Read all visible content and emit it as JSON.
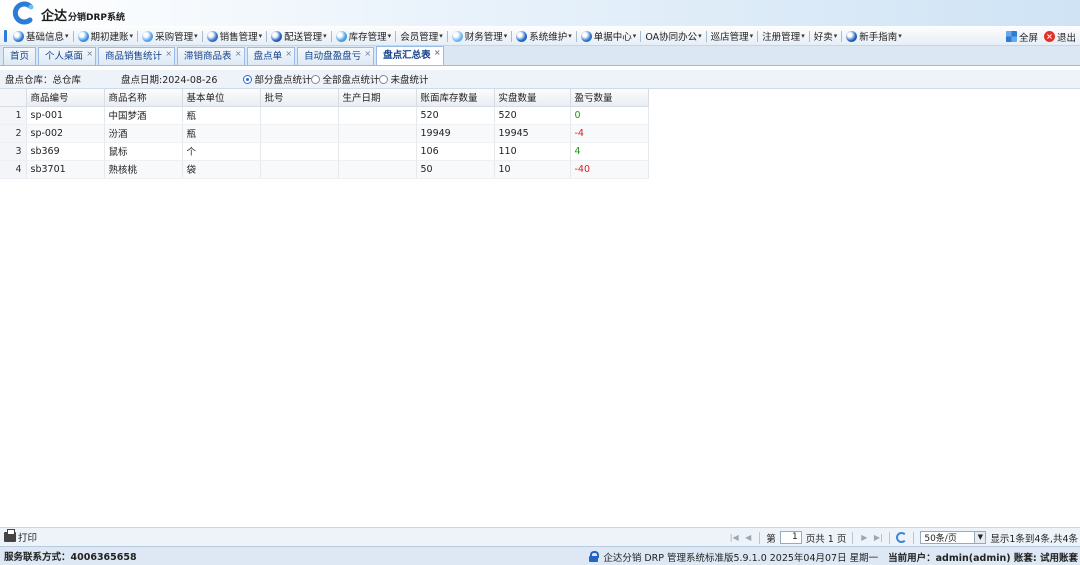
{
  "app": {
    "logo_text": "企达",
    "logo_sub": "分销DRP系统",
    "brand_color": "#2b7bd8"
  },
  "menu": [
    {
      "label": "基础信息",
      "icon": "info-icon",
      "color": "#2b7bd8"
    },
    {
      "label": "期初建账",
      "icon": "ledger-icon",
      "color": "#3a8fe0"
    },
    {
      "label": "采购管理",
      "icon": "purchase-icon",
      "color": "#5aa0e8"
    },
    {
      "label": "销售管理",
      "icon": "sales-icon",
      "color": "#2f6fc6"
    },
    {
      "label": "配送管理",
      "icon": "delivery-icon",
      "color": "#1e5fb8"
    },
    {
      "label": "库存管理",
      "icon": "inventory-icon",
      "color": "#4a9be0"
    },
    {
      "label": "会员管理",
      "icon": "",
      "color": ""
    },
    {
      "label": "财务管理",
      "icon": "finance-icon",
      "color": "#6cb2ee"
    },
    {
      "label": "系统维护",
      "icon": "system-icon",
      "color": "#1f66c2"
    },
    {
      "label": "单据中心",
      "icon": "document-icon",
      "color": "#2a72cc"
    },
    {
      "label": "OA协同办公",
      "icon": "",
      "color": ""
    },
    {
      "label": "巡店管理",
      "icon": "",
      "color": ""
    },
    {
      "label": "注册管理",
      "icon": "",
      "color": ""
    },
    {
      "label": "好卖",
      "icon": "",
      "color": ""
    },
    {
      "label": "新手指南",
      "icon": "guide-icon",
      "color": "#1f5fb8"
    }
  ],
  "menu_right": {
    "fullscreen_label": "全屏",
    "exit_label": "退出"
  },
  "tabs": [
    {
      "label": "首页",
      "closable": false,
      "active": false
    },
    {
      "label": "个人桌面",
      "closable": true,
      "active": false
    },
    {
      "label": "商品销售统计",
      "closable": true,
      "active": false
    },
    {
      "label": "滞销商品表",
      "closable": true,
      "active": false
    },
    {
      "label": "盘点单",
      "closable": true,
      "active": false
    },
    {
      "label": "自动盘盈盘亏",
      "closable": true,
      "active": false
    },
    {
      "label": "盘点汇总表",
      "closable": true,
      "active": true
    }
  ],
  "filter": {
    "warehouse": "盘点仓库：总仓库",
    "date": "盘点日期:2024-08-26",
    "options": [
      {
        "label": "部分盘点统计",
        "checked": true
      },
      {
        "label": "全部盘点统计",
        "checked": false
      },
      {
        "label": "未盘统计",
        "checked": false
      }
    ]
  },
  "grid": {
    "columns": [
      "商品编号",
      "商品名称",
      "基本单位",
      "批号",
      "生产日期",
      "账面库存数量",
      "实盘数量",
      "盈亏数量"
    ],
    "rows": [
      {
        "n": "1",
        "code": "sp-001",
        "name": "中国梦酒",
        "unit": "瓶",
        "batch": "",
        "date": "",
        "book": "520",
        "actual": "520",
        "diff": "0",
        "sign": "pos"
      },
      {
        "n": "2",
        "code": "sp-002",
        "name": "汾酒",
        "unit": "瓶",
        "batch": "",
        "date": "",
        "book": "19949",
        "actual": "19945",
        "diff": "-4",
        "sign": "neg"
      },
      {
        "n": "3",
        "code": "sb369",
        "name": "鼠标",
        "unit": "个",
        "batch": "",
        "date": "",
        "book": "106",
        "actual": "110",
        "diff": "4",
        "sign": "pos"
      },
      {
        "n": "4",
        "code": "sb3701",
        "name": "熟核桃",
        "unit": "袋",
        "batch": "",
        "date": "",
        "book": "50",
        "actual": "10",
        "diff": "-40",
        "sign": "neg"
      }
    ]
  },
  "toolbar": {
    "print_label": "打印"
  },
  "pager": {
    "page_prefix": "第",
    "page_value": "1",
    "page_suffix": "页共 1 页",
    "page_size": "50条/页",
    "summary": "显示1条到4条,共4条"
  },
  "status": {
    "contact": "服务联系方式：4006365658",
    "version": "企达分销 DRP 管理系统标准版5.9.1.0 2025年04月07日 星期一",
    "user_label": "当前用户：admin(admin) 账套: 试用账套"
  }
}
